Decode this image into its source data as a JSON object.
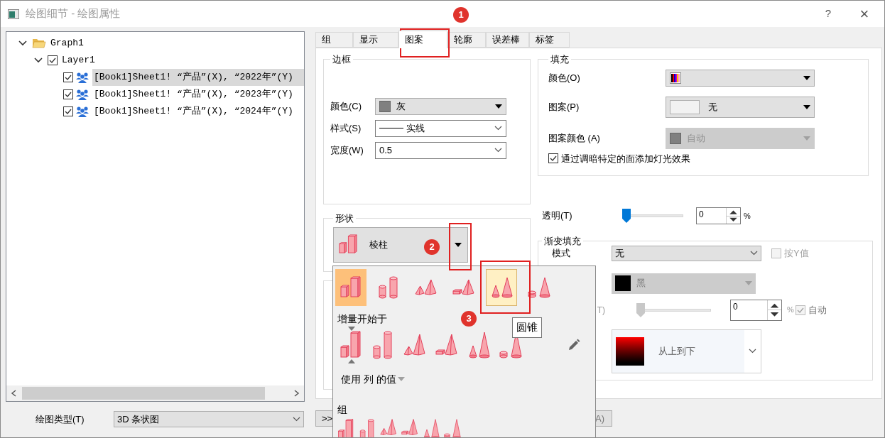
{
  "window": {
    "title": "绘图细节 - 绘图属性",
    "help": "?",
    "close": "×"
  },
  "tree": [
    {
      "label": "Graph1",
      "kind": "folder",
      "expanded": true,
      "children": [
        {
          "label": "Layer1",
          "kind": "layer",
          "checked": true,
          "expanded": true,
          "children": [
            {
              "label": "[Book1]Sheet1! “产品”(X), “2022年”(Y)",
              "kind": "plot",
              "checked": true,
              "selected": true
            },
            {
              "label": "[Book1]Sheet1! “产品”(X), “2023年”(Y)",
              "kind": "plot",
              "checked": true,
              "selected": false
            },
            {
              "label": "[Book1]Sheet1! “产品”(X), “2024年”(Y)",
              "kind": "plot",
              "checked": true,
              "selected": false
            }
          ]
        }
      ]
    }
  ],
  "plot_type": {
    "label": "绘图类型(T)",
    "value": "3D 条状图"
  },
  "tabs": [
    {
      "label": "组",
      "selected": false
    },
    {
      "label": "显示",
      "selected": false
    },
    {
      "label": "图案",
      "selected": true
    },
    {
      "label": "轮廓",
      "selected": false
    },
    {
      "label": "误差棒",
      "selected": false
    },
    {
      "label": "标签",
      "selected": false
    }
  ],
  "border_group": {
    "title": "边框",
    "fields": [
      {
        "label": "颜色(C)",
        "kind": "color",
        "value": "灰",
        "color": "#808080"
      },
      {
        "label": "样式(S)",
        "kind": "line",
        "value": "实线"
      },
      {
        "label": "宽度(W)",
        "kind": "text",
        "value": "0.5"
      }
    ]
  },
  "fill_group": {
    "title": "填充",
    "fields": [
      {
        "label": "颜色(O)",
        "kind": "palette",
        "disabled": false
      },
      {
        "label": "图案(P)",
        "kind": "pattern",
        "value": "无",
        "disabled": false
      },
      {
        "label": "图案颜色 (A)",
        "kind": "color",
        "value": "自动",
        "color": "#808080",
        "disabled": true
      }
    ],
    "lighting": {
      "label": "通过调暗特定的面添加灯光效果",
      "checked": true
    }
  },
  "transparency": {
    "label": "透明(T)",
    "level": 0,
    "value": "0",
    "unit": "%"
  },
  "shape_group": {
    "title": "形状",
    "value": "棱柱"
  },
  "gradient_group": {
    "title": "渐变填充",
    "mode": {
      "label": "模式",
      "value": "无"
    },
    "by_y": {
      "label": "按Y值",
      "checked": false,
      "disabled": true
    },
    "color": {
      "value": "黑",
      "color": "#000000",
      "disabled": true
    },
    "transparency": {
      "label": "T)",
      "level": 0,
      "value": "0",
      "unit": "%",
      "auto": {
        "label": "自动",
        "checked": true,
        "disabled": true
      }
    },
    "direction": {
      "value": "从上到下"
    }
  },
  "shape_popup": {
    "shapes": [
      {
        "kind": "prism",
        "selected": true,
        "hovered": false
      },
      {
        "kind": "cylinder",
        "selected": false,
        "hovered": false
      },
      {
        "kind": "pyramid",
        "selected": false,
        "hovered": false
      },
      {
        "kind": "pyramid_mixed",
        "selected": false,
        "hovered": false
      },
      {
        "kind": "cone",
        "selected": false,
        "hovered": true
      },
      {
        "kind": "cone_mixed",
        "selected": false,
        "hovered": false
      }
    ],
    "increment_label": "增量开始于",
    "column_values": "使用 列 的值",
    "group_label": "组"
  },
  "tooltip": "圆锥",
  "buttons": [
    {
      "label": ">>"
    },
    {
      "label": "A)"
    }
  ],
  "annotations": [
    {
      "number": "1"
    },
    {
      "number": "2"
    },
    {
      "number": "3"
    }
  ]
}
